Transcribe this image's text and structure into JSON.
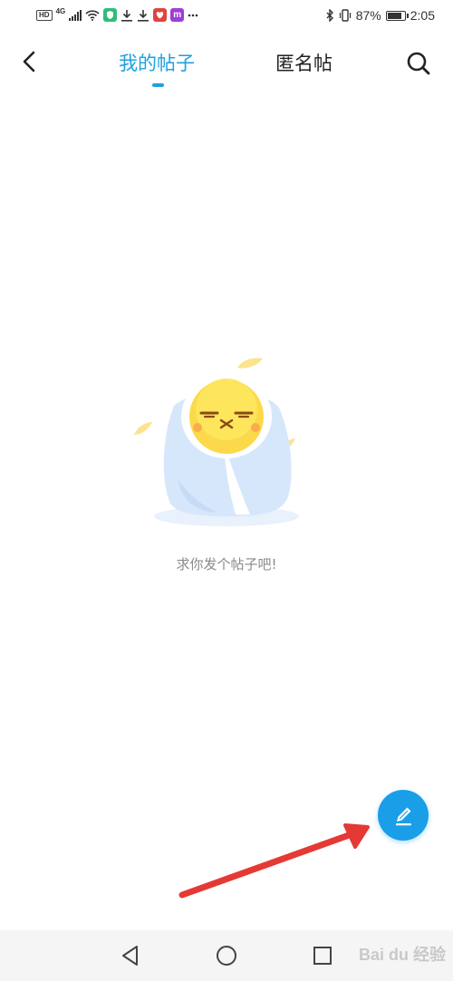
{
  "status_bar": {
    "hd": "HD",
    "network": "4G",
    "app_icon_3": "m",
    "battery": "87%",
    "time": "2:05",
    "battery_level": 0.87
  },
  "header": {
    "tabs": [
      {
        "label": "我的帖子",
        "active": true
      },
      {
        "label": "匿名帖",
        "active": false
      }
    ],
    "accent_color": "#1da1e0"
  },
  "empty_state": {
    "message": "求你发个帖子吧!"
  },
  "fab": {
    "icon": "pencil-icon",
    "color": "#1a9ee8"
  },
  "annotation": {
    "arrow_color": "#e53935"
  },
  "nav_bar": {
    "buttons": [
      "back-icon",
      "home-icon",
      "recent-apps-icon"
    ]
  },
  "watermark": {
    "text": "Bai du 经验"
  }
}
